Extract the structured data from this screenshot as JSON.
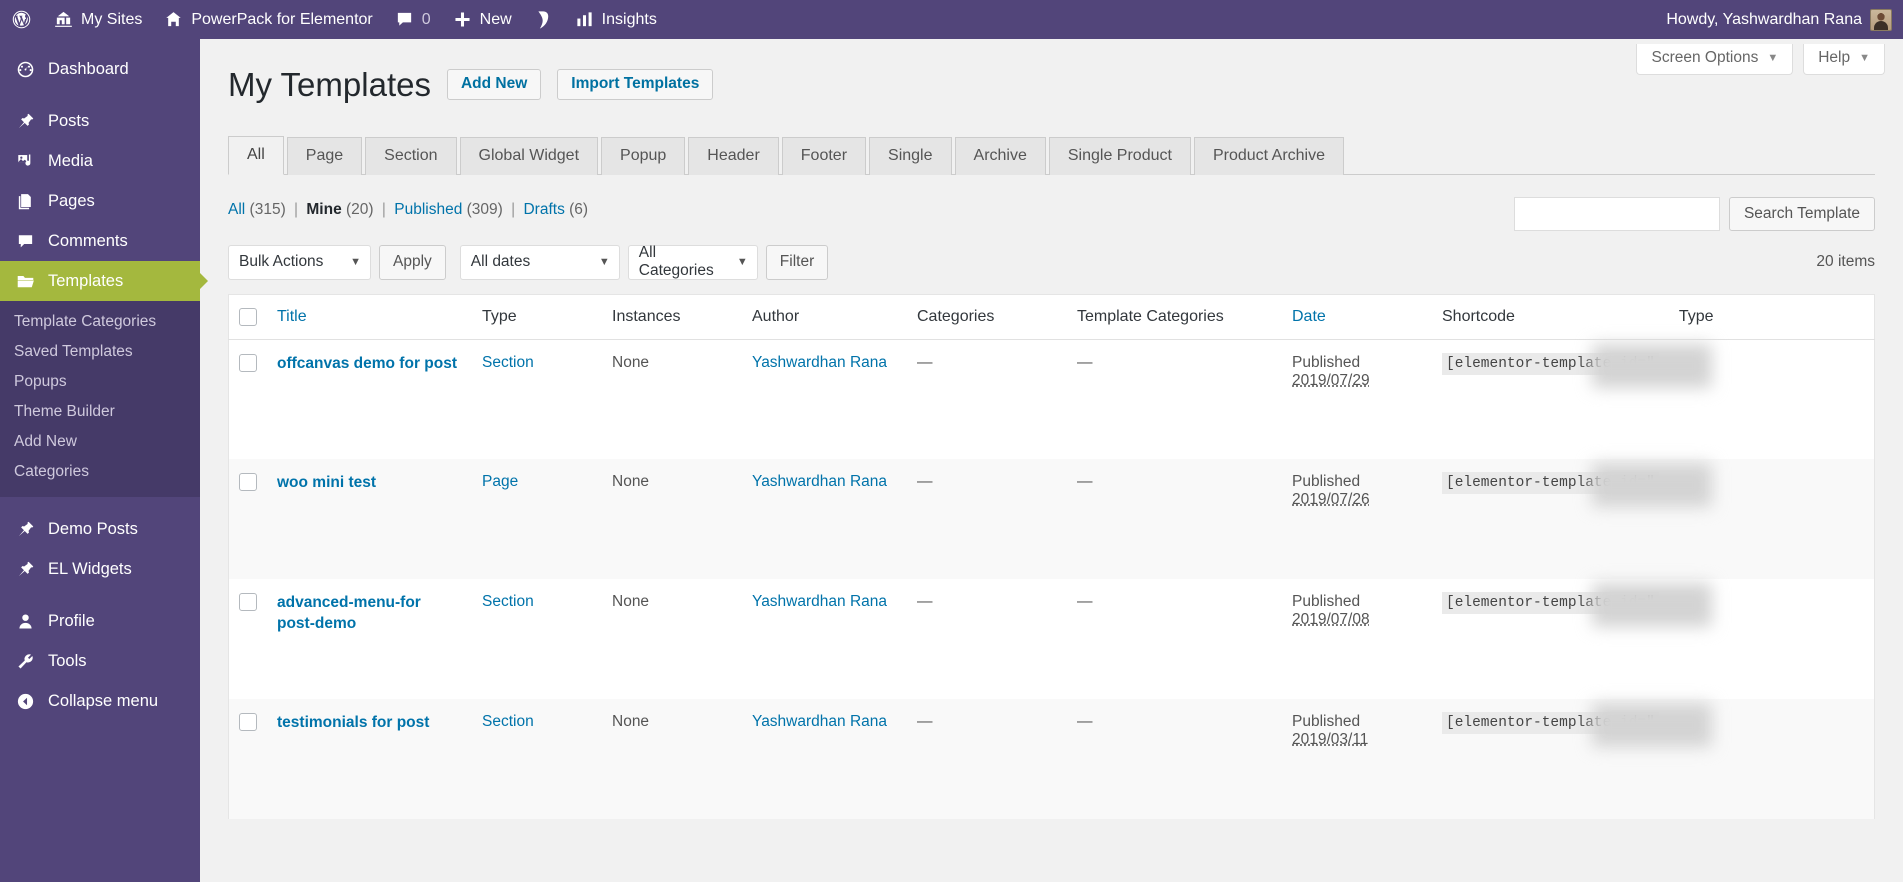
{
  "adminbar": {
    "items": [
      {
        "icon": "wordpress-logo-icon",
        "label": ""
      },
      {
        "icon": "multisite-icon",
        "label": "My Sites"
      },
      {
        "icon": "home-icon",
        "label": "PowerPack for Elementor"
      },
      {
        "icon": "comment-bubble-icon",
        "label": "0"
      },
      {
        "icon": "plus-icon",
        "label": "New"
      },
      {
        "icon": "yoast-seo-icon",
        "label": ""
      },
      {
        "icon": "insights-chart-icon",
        "label": "Insights"
      }
    ],
    "howdy": "Howdy, Yashwardhan Rana"
  },
  "sidebar": {
    "items": [
      {
        "label": "Dashboard",
        "icon": "dashboard-icon",
        "current": false
      },
      {
        "label": "Posts",
        "icon": "pin-icon",
        "current": false
      },
      {
        "label": "Media",
        "icon": "media-icon",
        "current": false
      },
      {
        "label": "Pages",
        "icon": "pages-icon",
        "current": false
      },
      {
        "label": "Comments",
        "icon": "comment-icon",
        "current": false
      },
      {
        "label": "Templates",
        "icon": "folder-icon",
        "current": true
      }
    ],
    "submenu": [
      {
        "label": "Template Categories"
      },
      {
        "label": "Saved Templates"
      },
      {
        "label": "Popups"
      },
      {
        "label": "Theme Builder"
      },
      {
        "label": "Add New"
      },
      {
        "label": "Categories"
      }
    ],
    "items2": [
      {
        "label": "Demo Posts",
        "icon": "pin-icon"
      },
      {
        "label": "EL Widgets",
        "icon": "pin-icon"
      }
    ],
    "items3": [
      {
        "label": "Profile",
        "icon": "user-icon"
      },
      {
        "label": "Tools",
        "icon": "wrench-icon"
      },
      {
        "label": "Collapse menu",
        "icon": "collapse-icon"
      }
    ]
  },
  "screen_meta": {
    "screen_options": "Screen Options",
    "help": "Help"
  },
  "page": {
    "title": "My Templates",
    "add_new": "Add New",
    "import_templates": "Import Templates"
  },
  "tabs": [
    {
      "label": "All",
      "active": true
    },
    {
      "label": "Page",
      "active": false
    },
    {
      "label": "Section",
      "active": false
    },
    {
      "label": "Global Widget",
      "active": false
    },
    {
      "label": "Popup",
      "active": false
    },
    {
      "label": "Header",
      "active": false
    },
    {
      "label": "Footer",
      "active": false
    },
    {
      "label": "Single",
      "active": false
    },
    {
      "label": "Archive",
      "active": false
    },
    {
      "label": "Single Product",
      "active": false
    },
    {
      "label": "Product Archive",
      "active": false
    }
  ],
  "status_links": [
    {
      "label": "All",
      "count": "(315)",
      "current": false
    },
    {
      "label": "Mine",
      "count": "(20)",
      "current": true
    },
    {
      "label": "Published",
      "count": "(309)",
      "current": false
    },
    {
      "label": "Drafts",
      "count": "(6)",
      "current": false
    }
  ],
  "search": {
    "value": "",
    "placeholder": "",
    "button": "Search Template"
  },
  "tablenav": {
    "bulk_actions": "Bulk Actions",
    "apply": "Apply",
    "all_dates": "All dates",
    "all_categories": "All Categories",
    "filter": "Filter",
    "items_count": "20 items"
  },
  "table": {
    "columns": [
      {
        "label": "Title",
        "sortable": true
      },
      {
        "label": "Type",
        "sortable": false
      },
      {
        "label": "Instances",
        "sortable": false
      },
      {
        "label": "Author",
        "sortable": false
      },
      {
        "label": "Categories",
        "sortable": false
      },
      {
        "label": "Template Categories",
        "sortable": false
      },
      {
        "label": "Date",
        "sortable": true
      },
      {
        "label": "Shortcode",
        "sortable": false
      },
      {
        "label": "Type",
        "sortable": false
      }
    ],
    "rows": [
      {
        "title": "offcanvas demo for post",
        "type": "Section",
        "instances": "None",
        "author": "Yashwardhan Rana",
        "categories": "—",
        "template_categories": "—",
        "date_status": "Published",
        "date_value": "2019/07/29",
        "shortcode": "[elementor-template id=\"",
        "type2": ""
      },
      {
        "title": "woo mini test",
        "type": "Page",
        "instances": "None",
        "author": "Yashwardhan Rana",
        "categories": "—",
        "template_categories": "—",
        "date_status": "Published",
        "date_value": "2019/07/26",
        "shortcode": "[elementor-template id=\"",
        "type2": ""
      },
      {
        "title": "advanced-menu-for post-demo",
        "type": "Section",
        "instances": "None",
        "author": "Yashwardhan Rana",
        "categories": "—",
        "template_categories": "—",
        "date_status": "Published",
        "date_value": "2019/07/08",
        "shortcode": "[elementor-template id=\"",
        "type2": ""
      },
      {
        "title": "testimonials for post",
        "type": "Section",
        "instances": "None",
        "author": "Yashwardhan Rana",
        "categories": "—",
        "template_categories": "—",
        "date_status": "Published",
        "date_value": "2019/03/11",
        "shortcode": "[elementor-template id=\"",
        "type2": ""
      }
    ]
  },
  "colors": {
    "admin_purple": "#52457a",
    "submenu_purple": "#453a68",
    "active_green": "#a4b83e",
    "link_blue": "#0073aa",
    "bg": "#f1f1f1"
  }
}
